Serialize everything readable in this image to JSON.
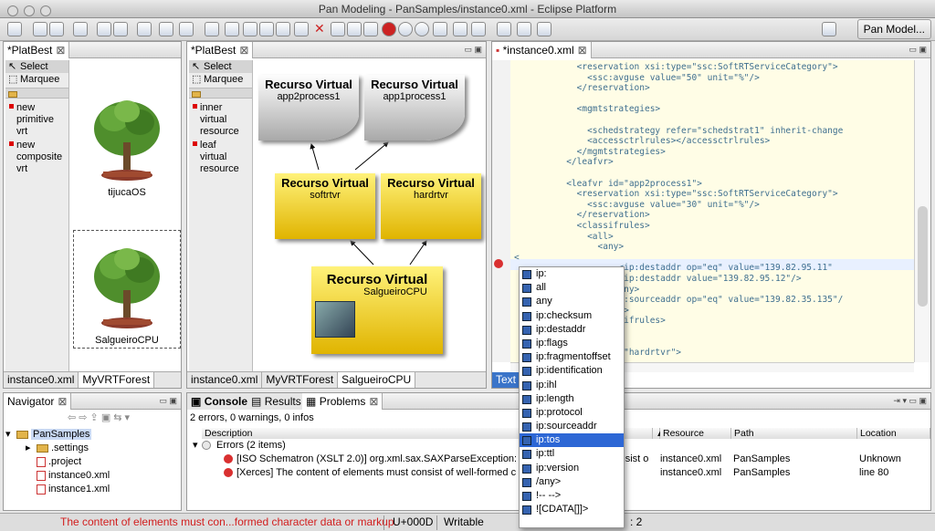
{
  "window": {
    "title": "Pan Modeling - PanSamples/instance0.xml - Eclipse Platform"
  },
  "toolbar": {
    "perspective_label": "Pan Model..."
  },
  "left_editor": {
    "tab": "*PlatBest",
    "palette": {
      "select": "Select",
      "marquee": "Marquee",
      "items": [
        "new primitive vrt",
        "new composite vrt"
      ]
    },
    "trees": [
      {
        "label": "tijucaOS"
      },
      {
        "label": "SalgueiroCPU"
      }
    ],
    "bottom_tabs": [
      "instance0.xml",
      "MyVRTForest"
    ]
  },
  "mid_editor": {
    "tab": "*PlatBest",
    "palette": {
      "select": "Select",
      "marquee": "Marquee",
      "items": [
        "inner virtual resource",
        "leaf virtual resource"
      ]
    },
    "nodes": [
      {
        "title": "Recurso Virtual",
        "subtitle": "app2process1"
      },
      {
        "title": "Recurso Virtual",
        "subtitle": "app1process1"
      },
      {
        "title": "Recurso Virtual",
        "subtitle": "softrtvr"
      },
      {
        "title": "Recurso Virtual",
        "subtitle": "hardrtvr"
      },
      {
        "title": "Recurso Virtual",
        "subtitle": "SalgueiroCPU"
      }
    ],
    "bottom_tabs": [
      "instance0.xml",
      "MyVRTForest",
      "SalgueiroCPU"
    ]
  },
  "xml_editor": {
    "tab": "*instance0.xml",
    "lines": [
      "            <reservation xsi:type=\"ssc:SoftRTServiceCategory\">",
      "              <ssc:avguse value=\"50\" unit=\"%\"/>",
      "            </reservation>",
      "",
      "            <mgmtstrategies>",
      "",
      "              <schedstrategy refer=\"schedstrat1\" inherit-change",
      "              <accessctrlrules></accessctrlrules>",
      "            </mgmtstrategies>",
      "          </leafvr>",
      "",
      "          <leafvr id=\"app2process1\">",
      "            <reservation xsi:type=\"ssc:SoftRTServiceCategory\">",
      "              <ssc:avguse value=\"30\" unit=\"%\"/>",
      "            </reservation>",
      "            <classifrules>",
      "              <all>",
      "                <any>",
      "<",
      "                    <ip:destaddr op=\"eq\" value=\"139.82.95.11\"",
      "                    <ip:destaddr value=\"139.82.95.12\"/>",
      "                  </any>",
      "                  <ip:sourceaddr op=\"eq\" value=\"139.82.35.135\"/",
      "                </all>",
      "              </classifrules>",
      "            </leafvr>",
      "          </leafvr>",
      "          <leafvr id=\"hardrtvr\">"
    ],
    "text_tab": "Text"
  },
  "autocomplete": {
    "items": [
      "ip:",
      "all",
      "any",
      "ip:checksum",
      "ip:destaddr",
      "ip:flags",
      "ip:fragmentoffset",
      "ip:identification",
      "ip:ihl",
      "ip:length",
      "ip:protocol",
      "ip:sourceaddr",
      "ip:tos",
      "ip:ttl",
      "ip:version",
      "/any>",
      "!-- -->",
      "![CDATA[]]>"
    ],
    "selected": "ip:tos"
  },
  "navigator": {
    "tab": "Navigator",
    "items": [
      {
        "label": "PanSamples",
        "kind": "project"
      },
      {
        "label": ".settings",
        "kind": "folder"
      },
      {
        "label": ".project",
        "kind": "file"
      },
      {
        "label": "instance0.xml",
        "kind": "file"
      },
      {
        "label": "instance1.xml",
        "kind": "file"
      }
    ]
  },
  "bottom_panel": {
    "tabs": [
      "Console",
      "Results",
      "Problems"
    ],
    "summary": "2 errors, 0 warnings, 0 infos",
    "columns": [
      "Description",
      "Resource",
      "Path",
      "Location"
    ],
    "group": "Errors (2 items)",
    "rows": [
      {
        "description": "[ISO Schematron (XSLT 2.0)] org.xml.sax.SAXParseException: The c",
        "tail": "consist o",
        "resource": "instance0.xml",
        "path": "PanSamples",
        "location": "Unknown"
      },
      {
        "description": "[Xerces] The content of elements must consist of well-formed chara",
        "tail": "",
        "resource": "instance0.xml",
        "path": "PanSamples",
        "location": "line 80"
      }
    ]
  },
  "statusbar": {
    "message": "The content of elements must con...formed character data or markup.",
    "encoding": "U+000D",
    "mode": "Writable",
    "position": ": 2"
  }
}
